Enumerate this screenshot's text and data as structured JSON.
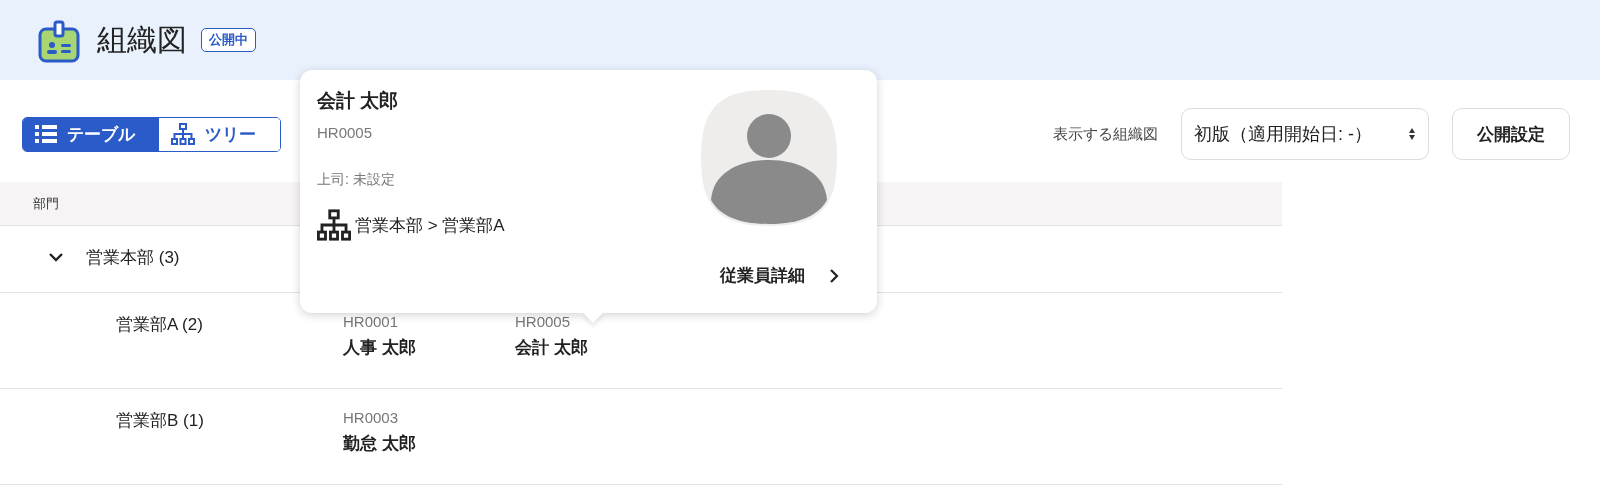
{
  "header": {
    "title": "組織図",
    "badge": "公開中"
  },
  "view_tabs": [
    {
      "label": "テーブル",
      "kind": "list",
      "selected": true
    },
    {
      "label": "ツリー",
      "kind": "tree",
      "selected": false
    }
  ],
  "chart_selector": {
    "label": "表示する組織図",
    "value": "初版（適用開始日: -）"
  },
  "publish_button": "公開設定",
  "table": {
    "columns": [
      "部門"
    ],
    "rows": [
      {
        "department": "営業本部 (3)",
        "expanded": true,
        "employees": [],
        "children": [
          {
            "department": "営業部A (2)",
            "employees": [
              {
                "code": "HR0001",
                "name": "人事 太郎"
              },
              {
                "code": "HR0005",
                "name": "会計 太郎"
              }
            ]
          },
          {
            "department": "営業部B (1)",
            "employees": [
              {
                "code": "HR0003",
                "name": "勤怠 太郎"
              }
            ]
          }
        ]
      }
    ]
  },
  "popover": {
    "name": "会計 太郎",
    "code": "HR0005",
    "manager": "上司: 未設定",
    "path": "営業本部 > 営業部A",
    "detail_link": "従業員詳細"
  }
}
